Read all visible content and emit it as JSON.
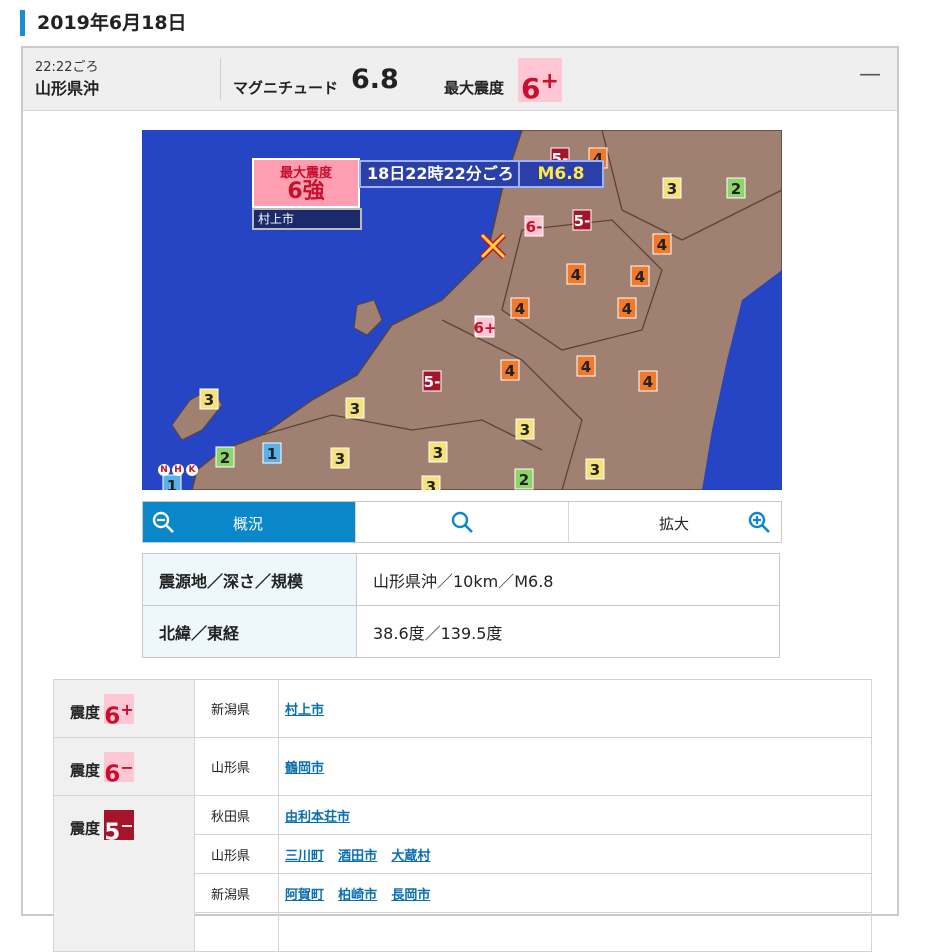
{
  "date_heading": "2019年6月18日",
  "quake": {
    "time": "22:22ごろ",
    "place": "山形県沖",
    "magnitude_label": "マグニチュード",
    "magnitude": "6.8",
    "max_intensity_label": "最大震度",
    "max_intensity": "6",
    "max_intensity_mod": "+",
    "collapse_symbol": "—"
  },
  "map": {
    "title_line1": "最大震度",
    "title_line2": "6強",
    "city": "村上市",
    "time_text": "18日22時22分ごろ",
    "mag_text": "M6.8",
    "logo": "NHK",
    "markers": [
      {
        "label": "5-",
        "color": "#a5152a"
      },
      {
        "label": "4",
        "color": "#f07a2a"
      },
      {
        "label": "3",
        "color": "#f5e27a"
      },
      {
        "label": "2",
        "color": "#8fd46a"
      },
      {
        "label": "6-",
        "color": "#ffc6d4"
      },
      {
        "label": "5-",
        "color": "#a5152a"
      },
      {
        "label": "4",
        "color": "#f07a2a"
      },
      {
        "label": "4",
        "color": "#f07a2a"
      },
      {
        "label": "4",
        "color": "#f07a2a"
      },
      {
        "label": "4",
        "color": "#f07a2a"
      },
      {
        "label": "4",
        "color": "#f07a2a"
      },
      {
        "label": "4",
        "color": "#f07a2a"
      },
      {
        "label": "6+",
        "color": "#ffc6d4"
      },
      {
        "label": "4",
        "color": "#f07a2a"
      },
      {
        "label": "4",
        "color": "#f07a2a"
      },
      {
        "label": "4",
        "color": "#f07a2a"
      },
      {
        "label": "5-",
        "color": "#a5152a"
      },
      {
        "label": "3",
        "color": "#f5e27a"
      },
      {
        "label": "3",
        "color": "#f5e27a"
      },
      {
        "label": "1",
        "color": "#5ab0e8"
      },
      {
        "label": "2",
        "color": "#8fd46a"
      },
      {
        "label": "3",
        "color": "#f5e27a"
      },
      {
        "label": "3",
        "color": "#f5e27a"
      },
      {
        "label": "3",
        "color": "#f5e27a"
      },
      {
        "label": "2",
        "color": "#8fd46a"
      },
      {
        "label": "3",
        "color": "#f5e27a"
      },
      {
        "label": "3",
        "color": "#f5e27a"
      },
      {
        "label": "1",
        "color": "#5ab0e8"
      }
    ]
  },
  "zoom": {
    "overview_label": "概況",
    "enlarge_label": "拡大"
  },
  "info": [
    {
      "key": "震源地／深さ／規模",
      "value": "山形県沖／10km／M6.8"
    },
    {
      "key": "北緯／東経",
      "value": "38.6度／139.5度"
    }
  ],
  "intensity_label": "震度",
  "intensities": [
    {
      "level": "6",
      "mod": "+",
      "rows": [
        {
          "pref": "新潟県",
          "towns": [
            "村上市"
          ]
        }
      ]
    },
    {
      "level": "6",
      "mod": "−",
      "rows": [
        {
          "pref": "山形県",
          "towns": [
            "鶴岡市"
          ]
        }
      ]
    },
    {
      "level": "5",
      "mod": "−",
      "rows": [
        {
          "pref": "秋田県",
          "towns": [
            "由利本荘市"
          ]
        },
        {
          "pref": "山形県",
          "towns": [
            "三川町",
            "酒田市",
            "大蔵村"
          ]
        },
        {
          "pref": "新潟県",
          "towns": [
            "阿賀町",
            "柏崎市",
            "長岡市"
          ]
        }
      ]
    }
  ]
}
